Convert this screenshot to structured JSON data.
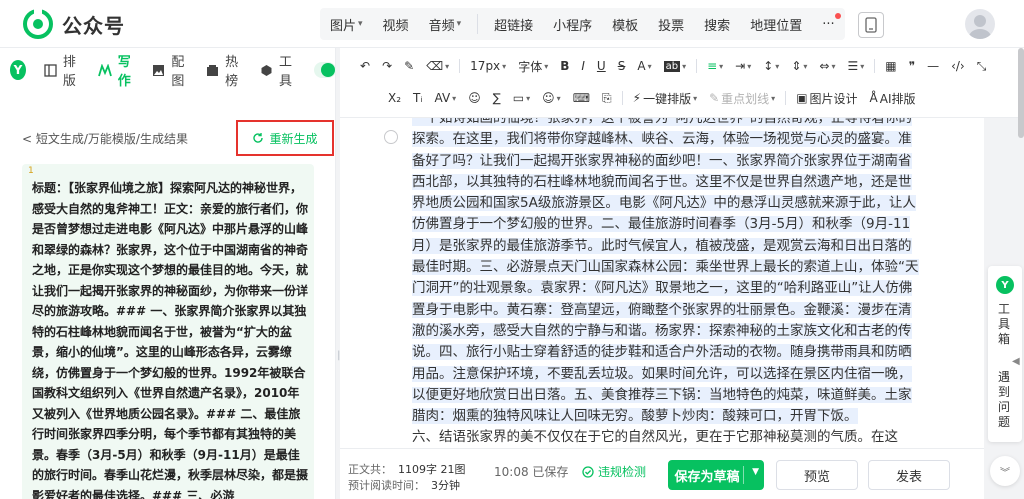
{
  "app": {
    "name": "公众号"
  },
  "topbar": {
    "groups": [
      [
        {
          "label": "图片",
          "caret": true
        },
        {
          "label": "视频",
          "caret": false
        },
        {
          "label": "音频",
          "caret": true
        }
      ],
      [
        {
          "label": "超链接",
          "caret": false
        },
        {
          "label": "小程序",
          "caret": false
        },
        {
          "label": "模板",
          "caret": false
        },
        {
          "label": "投票",
          "caret": false
        },
        {
          "label": "搜索",
          "caret": false
        },
        {
          "label": "地理位置",
          "caret": false
        }
      ]
    ],
    "more_label": "···"
  },
  "left": {
    "brand_letter": "Y",
    "tabs": [
      {
        "label": "排版",
        "active": false,
        "icon": "layout-icon"
      },
      {
        "label": "写作",
        "active": true,
        "icon": "write-icon"
      },
      {
        "label": "配图",
        "active": false,
        "icon": "image-icon"
      },
      {
        "label": "热榜",
        "active": false,
        "icon": "hot-icon"
      },
      {
        "label": "工具",
        "active": false,
        "icon": "tool-icon"
      }
    ],
    "breadcrumb": "< 短文生成/万能模版/生成结果",
    "regenerate_label": "重新生成",
    "result_index": "1",
    "result_text": "标题：【张家界仙境之旅】探索阿凡达的神秘世界，感受大自然的鬼斧神工！正文：亲爱的旅行者们，你是否曾梦想过走进电影《阿凡达》中那片悬浮的山峰和翠绿的森林？张家界，这个位于中国湖南省的神奇之地，正是你实现这个梦想的最佳目的地。今天，就让我们一起揭开张家界的神秘面纱，为你带来一份详尽的旅游攻略。### 一、张家界简介张家界以其独特的石柱峰林地貌而闻名于世，被誉为“扩大的盆景，缩小的仙境”。这里的山峰形态各异，云雾缭绕，仿佛置身于一个梦幻般的世界。1992年被联合国教科文组织列入《世界自然遗产名录》，2010年又被列入《世界地质公园名录》。### 二、最佳旅行时间张家界四季分明，每个季节都有其独特的美景。春季（3月-5月）和秋季（9月-11月）是最佳的旅行时间。春季山花烂漫，秋季层林尽染，都是摄影爱好者的最佳选择。### 三、必游"
  },
  "editor_toolbar": {
    "row1": [
      "↶",
      "↷",
      "🖌",
      "⛭",
      "17px",
      "字体",
      "B",
      "I",
      "U",
      "S",
      "A",
      "ab",
      "≡",
      "≡",
      "≡",
      "≡",
      "≡",
      "≡",
      "≡",
      "⊞",
      "❞",
      "—",
      "‹/›",
      "⇆"
    ],
    "font_size": "17px",
    "font_label": "字体",
    "row2_actions": [
      {
        "label": "一键排版",
        "caret": true,
        "disabled": false
      },
      {
        "label": "重点划线",
        "caret": true,
        "disabled": true
      },
      {
        "label": "图片设计",
        "caret": false,
        "disabled": false
      },
      {
        "label": "AI排版",
        "caret": false,
        "disabled": false
      }
    ]
  },
  "article": {
    "text": "一个如诗如画的仙境？张家界，这个被誉为“阿凡达世界”的自然奇观，正等待着你的探索。在这里，我们将带你穿越峰林、峡谷、云海，体验一场视觉与心灵的盛宴。准备好了吗？让我们一起揭开张家界神秘的面纱吧！一、张家界简介张家界位于湖南省西北部，以其独特的石柱峰林地貌而闻名于世。这里不仅是世界自然遗产地，还是世界地质公园和国家5A级旅游景区。电影《阿凡达》中的悬浮山灵感就来源于此，让人仿佛置身于一个梦幻般的世界。二、最佳旅游时间春季（3月-5月）和秋季（9月-11月）是张家界的最佳旅游季节。此时气候宜人，植被茂盛，是观赏云海和日出日落的最佳时期。三、必游景点天门山国家森林公园：乘坐世界上最长的索道上山，体验“天门洞开”的壮观景象。袁家界：《阿凡达》取景地之一，这里的“哈利路亚山”让人仿佛置身于电影中。黄石寨：登高望远，俯瞰整个张家界的壮丽景色。金鞭溪：漫步在清澈的溪水旁，感受大自然的宁静与和谐。杨家界：探索神秘的土家族文化和古老的传说。四、旅行小贴士穿着舒适的徒步鞋和适合户外活动的衣物。随身携带雨具和防晒用品。注意保护环境，不要乱丢垃圾。如果时间允许，可以选择在景区内住宿一晚，以便更好地欣赏日出日落。五、美食推荐三下锅：当地特色的炖菜，味道鲜美。土家腊肉：烟熏的独特风味让人回味无穷。酸萝卜炒肉：酸辣可口，开胃下饭。",
    "tail": "六、结语张家界的美不仅仅在于它的自然风光，更在于它那神秘莫测的气质。在这里，你可以远离都市的喧嚣，感受大自然的宁静与和谐。无论是徒步探险还是静坐观"
  },
  "status": {
    "word_label": "正文共：",
    "word_count": "1109字 21图",
    "read_label": "预计阅读时间：",
    "read_time": "3分钟",
    "saved": "10:08  已保存",
    "check_label": "违规检测"
  },
  "buttons": {
    "save": "保存为草稿",
    "preview": "预览",
    "publish": "发表"
  },
  "rightside": {
    "badge": "Y",
    "toolbox_label": "工具箱",
    "feedback_label": "遇到问题"
  },
  "colors": {
    "accent": "#07c160",
    "highlight_box": "#e5322d",
    "selection": "#e8f0fd"
  }
}
